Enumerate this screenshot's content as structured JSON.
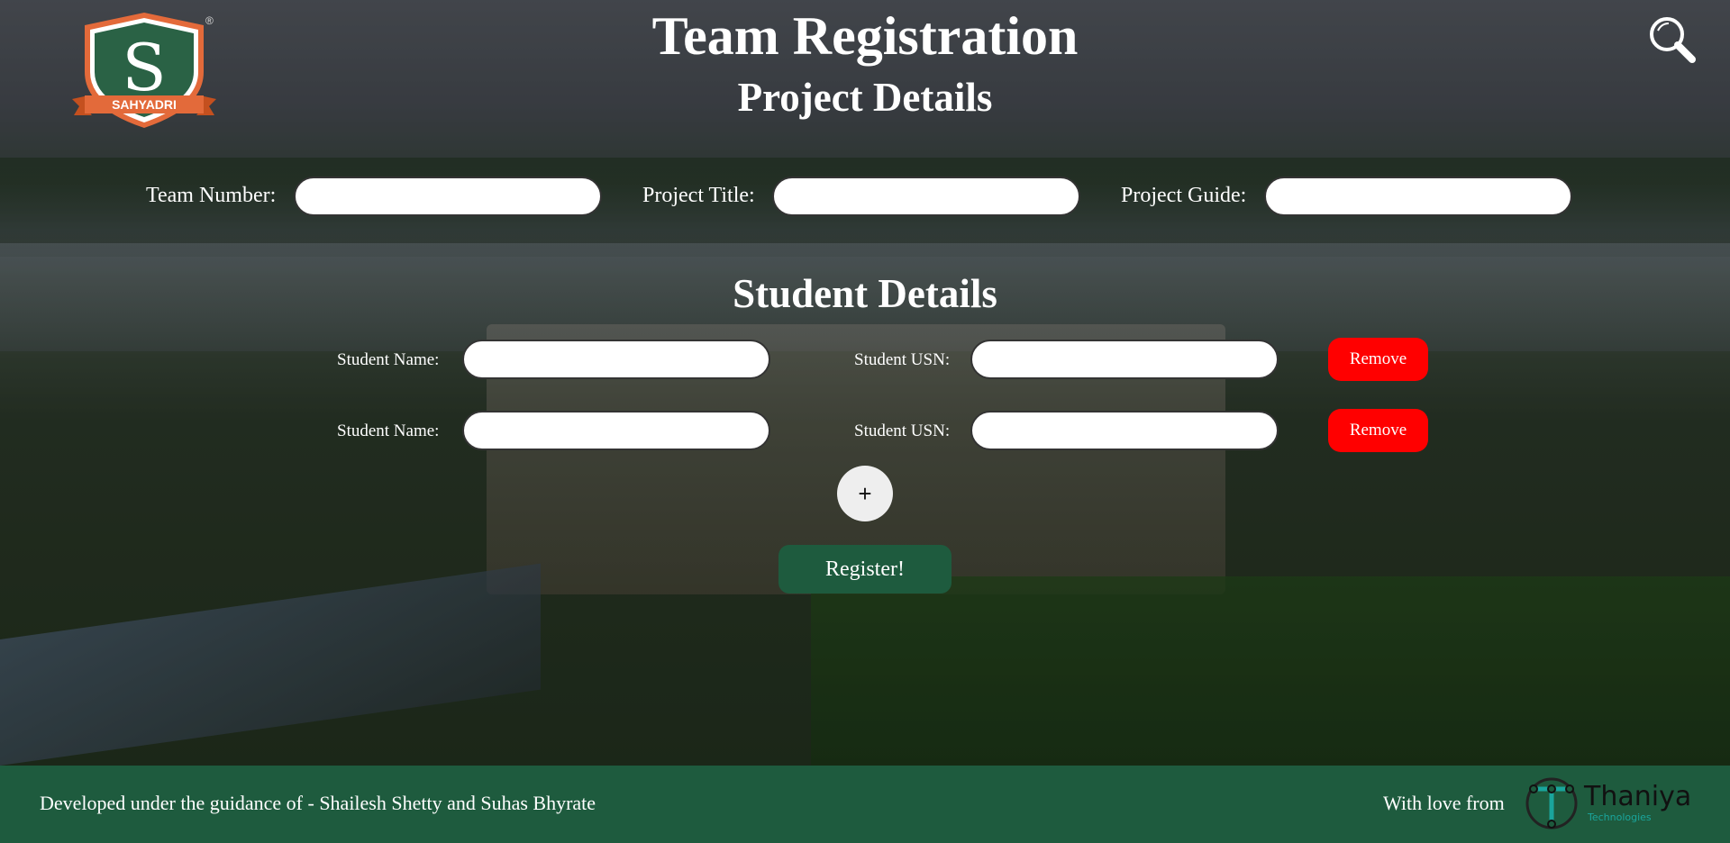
{
  "header": {
    "logo_text": "SAHYADRI",
    "logo_letter": "S",
    "registered_mark": "®",
    "title": "Team Registration",
    "subtitle": "Project Details"
  },
  "project": {
    "team_number_label": "Team Number:",
    "team_number_value": "",
    "project_title_label": "Project Title:",
    "project_title_value": "",
    "project_guide_label": "Project Guide:",
    "project_guide_value": ""
  },
  "students": {
    "heading": "Student Details",
    "rows": [
      {
        "name_label": "Student Name:",
        "name_value": "",
        "usn_label": "Student USN:",
        "usn_value": "",
        "remove_label": "Remove"
      },
      {
        "name_label": "Student Name:",
        "name_value": "",
        "usn_label": "Student USN:",
        "usn_value": "",
        "remove_label": "Remove"
      }
    ],
    "add_label": "+",
    "register_label": "Register!"
  },
  "footer": {
    "guidance_text": "Developed under the guidance of - Shailesh Shetty and Suhas Bhyrate",
    "love_text": "With love from",
    "brand_name": "Thaniya",
    "brand_sub": "Technologies"
  },
  "icons": {
    "search": "search-icon",
    "logo": "sahyadri-logo-icon",
    "brand": "thaniya-logo-icon"
  },
  "colors": {
    "footer_bg": "#1e5b3e",
    "register_bg": "#1e5b3e",
    "remove_bg": "#ff0000",
    "logo_green": "#2a6245",
    "logo_orange": "#e36a3a",
    "brand_teal": "#1aa59c"
  }
}
